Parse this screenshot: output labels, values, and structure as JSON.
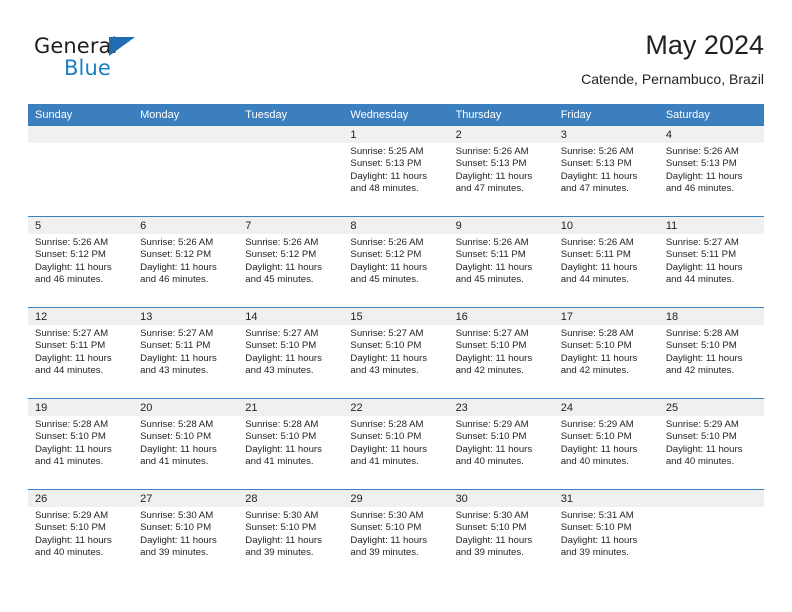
{
  "brand": {
    "name_part1": "General",
    "name_part2": "Blue",
    "triangle_color": "#1f6cb0",
    "blue_color": "#1b7fc4"
  },
  "header": {
    "title": "May 2024",
    "subtitle": "Catende, Pernambuco, Brazil"
  },
  "theme": {
    "header_bg": "#3b7fbf",
    "daynum_band_bg": "#f0f0f0",
    "text": "#231f20"
  },
  "weekday_headers": [
    "Sunday",
    "Monday",
    "Tuesday",
    "Wednesday",
    "Thursday",
    "Friday",
    "Saturday"
  ],
  "weeks": [
    [
      {
        "day": "",
        "sunrise": "",
        "sunset": "",
        "daylight_line1": "",
        "daylight_line2": ""
      },
      {
        "day": "",
        "sunrise": "",
        "sunset": "",
        "daylight_line1": "",
        "daylight_line2": ""
      },
      {
        "day": "",
        "sunrise": "",
        "sunset": "",
        "daylight_line1": "",
        "daylight_line2": ""
      },
      {
        "day": "1",
        "sunrise": "Sunrise: 5:25 AM",
        "sunset": "Sunset: 5:13 PM",
        "daylight_line1": "Daylight: 11 hours",
        "daylight_line2": "and 48 minutes."
      },
      {
        "day": "2",
        "sunrise": "Sunrise: 5:26 AM",
        "sunset": "Sunset: 5:13 PM",
        "daylight_line1": "Daylight: 11 hours",
        "daylight_line2": "and 47 minutes."
      },
      {
        "day": "3",
        "sunrise": "Sunrise: 5:26 AM",
        "sunset": "Sunset: 5:13 PM",
        "daylight_line1": "Daylight: 11 hours",
        "daylight_line2": "and 47 minutes."
      },
      {
        "day": "4",
        "sunrise": "Sunrise: 5:26 AM",
        "sunset": "Sunset: 5:13 PM",
        "daylight_line1": "Daylight: 11 hours",
        "daylight_line2": "and 46 minutes."
      }
    ],
    [
      {
        "day": "5",
        "sunrise": "Sunrise: 5:26 AM",
        "sunset": "Sunset: 5:12 PM",
        "daylight_line1": "Daylight: 11 hours",
        "daylight_line2": "and 46 minutes."
      },
      {
        "day": "6",
        "sunrise": "Sunrise: 5:26 AM",
        "sunset": "Sunset: 5:12 PM",
        "daylight_line1": "Daylight: 11 hours",
        "daylight_line2": "and 46 minutes."
      },
      {
        "day": "7",
        "sunrise": "Sunrise: 5:26 AM",
        "sunset": "Sunset: 5:12 PM",
        "daylight_line1": "Daylight: 11 hours",
        "daylight_line2": "and 45 minutes."
      },
      {
        "day": "8",
        "sunrise": "Sunrise: 5:26 AM",
        "sunset": "Sunset: 5:12 PM",
        "daylight_line1": "Daylight: 11 hours",
        "daylight_line2": "and 45 minutes."
      },
      {
        "day": "9",
        "sunrise": "Sunrise: 5:26 AM",
        "sunset": "Sunset: 5:11 PM",
        "daylight_line1": "Daylight: 11 hours",
        "daylight_line2": "and 45 minutes."
      },
      {
        "day": "10",
        "sunrise": "Sunrise: 5:26 AM",
        "sunset": "Sunset: 5:11 PM",
        "daylight_line1": "Daylight: 11 hours",
        "daylight_line2": "and 44 minutes."
      },
      {
        "day": "11",
        "sunrise": "Sunrise: 5:27 AM",
        "sunset": "Sunset: 5:11 PM",
        "daylight_line1": "Daylight: 11 hours",
        "daylight_line2": "and 44 minutes."
      }
    ],
    [
      {
        "day": "12",
        "sunrise": "Sunrise: 5:27 AM",
        "sunset": "Sunset: 5:11 PM",
        "daylight_line1": "Daylight: 11 hours",
        "daylight_line2": "and 44 minutes."
      },
      {
        "day": "13",
        "sunrise": "Sunrise: 5:27 AM",
        "sunset": "Sunset: 5:11 PM",
        "daylight_line1": "Daylight: 11 hours",
        "daylight_line2": "and 43 minutes."
      },
      {
        "day": "14",
        "sunrise": "Sunrise: 5:27 AM",
        "sunset": "Sunset: 5:10 PM",
        "daylight_line1": "Daylight: 11 hours",
        "daylight_line2": "and 43 minutes."
      },
      {
        "day": "15",
        "sunrise": "Sunrise: 5:27 AM",
        "sunset": "Sunset: 5:10 PM",
        "daylight_line1": "Daylight: 11 hours",
        "daylight_line2": "and 43 minutes."
      },
      {
        "day": "16",
        "sunrise": "Sunrise: 5:27 AM",
        "sunset": "Sunset: 5:10 PM",
        "daylight_line1": "Daylight: 11 hours",
        "daylight_line2": "and 42 minutes."
      },
      {
        "day": "17",
        "sunrise": "Sunrise: 5:28 AM",
        "sunset": "Sunset: 5:10 PM",
        "daylight_line1": "Daylight: 11 hours",
        "daylight_line2": "and 42 minutes."
      },
      {
        "day": "18",
        "sunrise": "Sunrise: 5:28 AM",
        "sunset": "Sunset: 5:10 PM",
        "daylight_line1": "Daylight: 11 hours",
        "daylight_line2": "and 42 minutes."
      }
    ],
    [
      {
        "day": "19",
        "sunrise": "Sunrise: 5:28 AM",
        "sunset": "Sunset: 5:10 PM",
        "daylight_line1": "Daylight: 11 hours",
        "daylight_line2": "and 41 minutes."
      },
      {
        "day": "20",
        "sunrise": "Sunrise: 5:28 AM",
        "sunset": "Sunset: 5:10 PM",
        "daylight_line1": "Daylight: 11 hours",
        "daylight_line2": "and 41 minutes."
      },
      {
        "day": "21",
        "sunrise": "Sunrise: 5:28 AM",
        "sunset": "Sunset: 5:10 PM",
        "daylight_line1": "Daylight: 11 hours",
        "daylight_line2": "and 41 minutes."
      },
      {
        "day": "22",
        "sunrise": "Sunrise: 5:28 AM",
        "sunset": "Sunset: 5:10 PM",
        "daylight_line1": "Daylight: 11 hours",
        "daylight_line2": "and 41 minutes."
      },
      {
        "day": "23",
        "sunrise": "Sunrise: 5:29 AM",
        "sunset": "Sunset: 5:10 PM",
        "daylight_line1": "Daylight: 11 hours",
        "daylight_line2": "and 40 minutes."
      },
      {
        "day": "24",
        "sunrise": "Sunrise: 5:29 AM",
        "sunset": "Sunset: 5:10 PM",
        "daylight_line1": "Daylight: 11 hours",
        "daylight_line2": "and 40 minutes."
      },
      {
        "day": "25",
        "sunrise": "Sunrise: 5:29 AM",
        "sunset": "Sunset: 5:10 PM",
        "daylight_line1": "Daylight: 11 hours",
        "daylight_line2": "and 40 minutes."
      }
    ],
    [
      {
        "day": "26",
        "sunrise": "Sunrise: 5:29 AM",
        "sunset": "Sunset: 5:10 PM",
        "daylight_line1": "Daylight: 11 hours",
        "daylight_line2": "and 40 minutes."
      },
      {
        "day": "27",
        "sunrise": "Sunrise: 5:30 AM",
        "sunset": "Sunset: 5:10 PM",
        "daylight_line1": "Daylight: 11 hours",
        "daylight_line2": "and 39 minutes."
      },
      {
        "day": "28",
        "sunrise": "Sunrise: 5:30 AM",
        "sunset": "Sunset: 5:10 PM",
        "daylight_line1": "Daylight: 11 hours",
        "daylight_line2": "and 39 minutes."
      },
      {
        "day": "29",
        "sunrise": "Sunrise: 5:30 AM",
        "sunset": "Sunset: 5:10 PM",
        "daylight_line1": "Daylight: 11 hours",
        "daylight_line2": "and 39 minutes."
      },
      {
        "day": "30",
        "sunrise": "Sunrise: 5:30 AM",
        "sunset": "Sunset: 5:10 PM",
        "daylight_line1": "Daylight: 11 hours",
        "daylight_line2": "and 39 minutes."
      },
      {
        "day": "31",
        "sunrise": "Sunrise: 5:31 AM",
        "sunset": "Sunset: 5:10 PM",
        "daylight_line1": "Daylight: 11 hours",
        "daylight_line2": "and 39 minutes."
      },
      {
        "day": "",
        "sunrise": "",
        "sunset": "",
        "daylight_line1": "",
        "daylight_line2": ""
      }
    ]
  ]
}
